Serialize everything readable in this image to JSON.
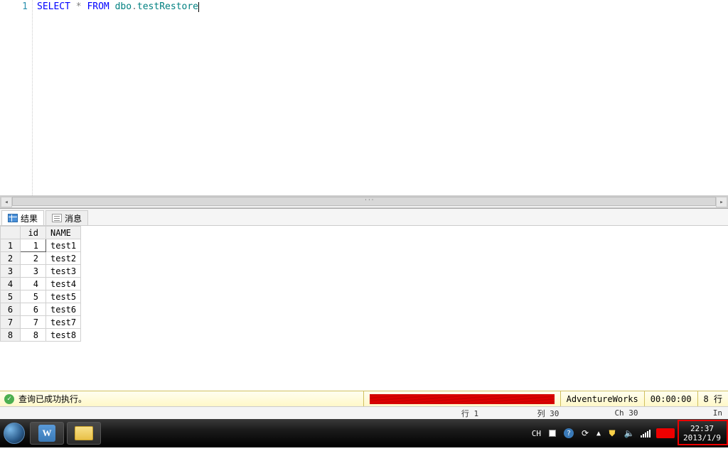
{
  "editor": {
    "line_number": "1",
    "tokens": {
      "select": "SELECT",
      "star": "*",
      "from": "FROM",
      "schema": "dbo",
      "dot": ".",
      "table": "testRestore"
    }
  },
  "scroll_marker": "'''",
  "tabs": {
    "results": "结果",
    "messages": "消息"
  },
  "grid": {
    "columns": {
      "blank": "",
      "id": "id",
      "name": "NAME"
    },
    "rows": [
      {
        "n": "1",
        "id": "1",
        "name": "test1"
      },
      {
        "n": "2",
        "id": "2",
        "name": "test2"
      },
      {
        "n": "3",
        "id": "3",
        "name": "test3"
      },
      {
        "n": "4",
        "id": "4",
        "name": "test4"
      },
      {
        "n": "5",
        "id": "5",
        "name": "test5"
      },
      {
        "n": "6",
        "id": "6",
        "name": "test6"
      },
      {
        "n": "7",
        "id": "7",
        "name": "test7"
      },
      {
        "n": "8",
        "id": "8",
        "name": "test8"
      }
    ]
  },
  "status": {
    "success": "查询已成功执行。",
    "database": "AdventureWorks",
    "elapsed": "00:00:00",
    "rows": "8 行"
  },
  "position": {
    "row": "行 1",
    "col": "列 30",
    "ch": "Ch 30",
    "ins": "In"
  },
  "taskbar": {
    "word": "W",
    "lang": "CH",
    "help": "?",
    "chev": "▲",
    "time": "22:37",
    "date": "2013/1/9"
  }
}
